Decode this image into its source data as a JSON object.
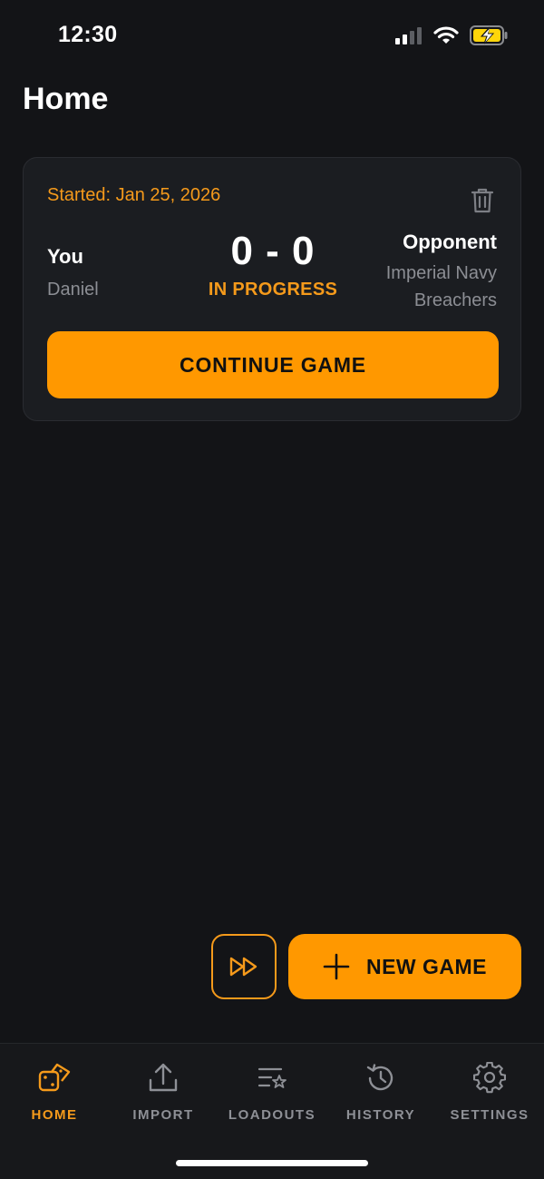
{
  "status_bar": {
    "time": "12:30"
  },
  "page": {
    "title": "Home"
  },
  "game_card": {
    "started": "Started: Jan 25, 2026",
    "player_label": "You",
    "player_name": "Daniel",
    "score": "0 - 0",
    "status": "IN PROGRESS",
    "opponent_label": "Opponent",
    "opponent_name": "Imperial Navy Breachers",
    "continue_label": "CONTINUE GAME"
  },
  "actions": {
    "new_game_label": "NEW GAME"
  },
  "tabs": [
    {
      "id": "home",
      "label": "HOME",
      "icon": "dice-icon",
      "active": true
    },
    {
      "id": "import",
      "label": "IMPORT",
      "icon": "upload-icon",
      "active": false
    },
    {
      "id": "loadouts",
      "label": "LOADOUTS",
      "icon": "list-star-icon",
      "active": false
    },
    {
      "id": "history",
      "label": "HISTORY",
      "icon": "history-icon",
      "active": false
    },
    {
      "id": "settings",
      "label": "SETTINGS",
      "icon": "gear-icon",
      "active": false
    }
  ],
  "colors": {
    "accent": "#ff9800",
    "background": "#131417",
    "card": "#1b1d21",
    "muted": "#8e9096"
  }
}
